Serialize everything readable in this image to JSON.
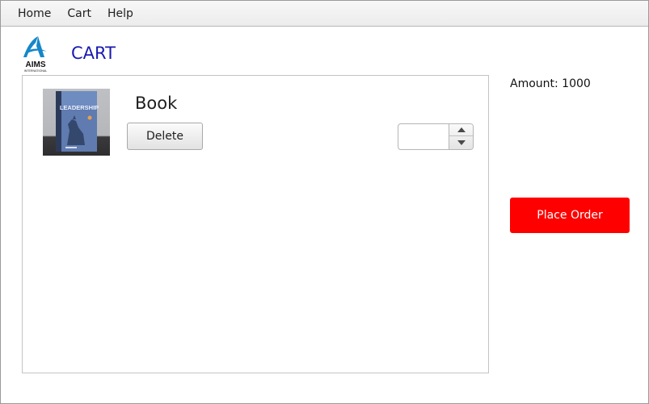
{
  "menubar": {
    "items": [
      {
        "label": "Home"
      },
      {
        "label": "Cart"
      },
      {
        "label": "Help"
      }
    ]
  },
  "header": {
    "logo_text": "AIMS",
    "logo_subtext": "INTERNATIONAL",
    "title": "CART"
  },
  "cart": {
    "items": [
      {
        "title": "Book",
        "delete_label": "Delete",
        "quantity": "",
        "cover_text": "LEADERSHIP"
      }
    ]
  },
  "summary": {
    "amount": "Amount: 1000",
    "place_order_label": "Place Order"
  },
  "colors": {
    "title": "#1a1ab0",
    "place_order": "#ff0000",
    "logo": "#1587c9"
  }
}
